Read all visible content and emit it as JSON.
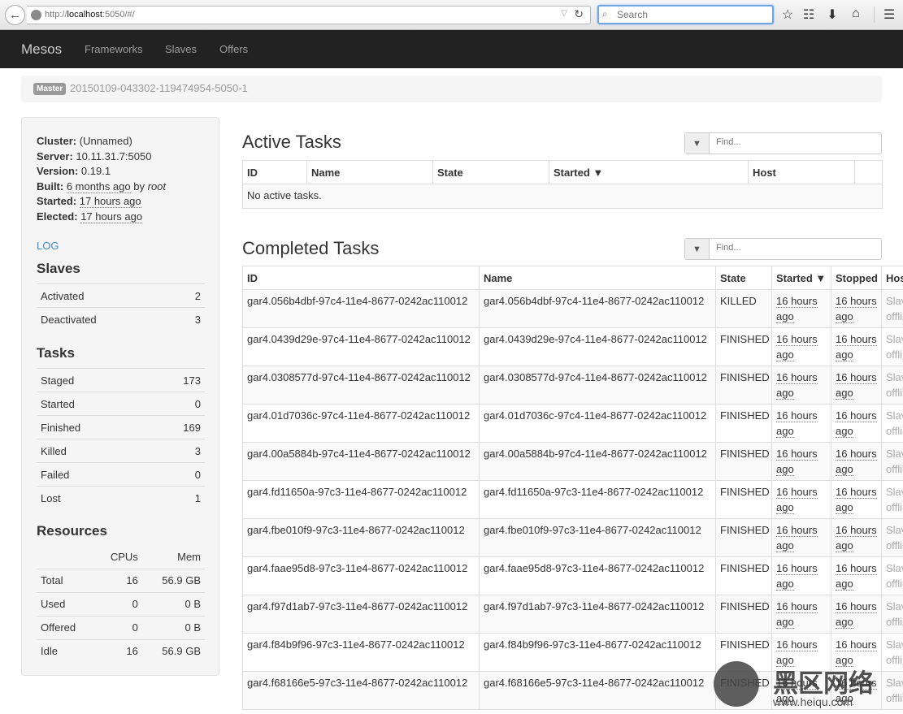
{
  "browser": {
    "url_prefix": "http://",
    "url_host": "localhost",
    "url_suffix": ":5050/#/",
    "search_placeholder": "Search"
  },
  "nav": {
    "brand": "Mesos",
    "links": [
      "Frameworks",
      "Slaves",
      "Offers"
    ]
  },
  "breadcrumb": {
    "label": "Master",
    "id": "20150109-043302-119474954-5050-1"
  },
  "cluster": {
    "cluster_label": "Cluster:",
    "cluster": "(Unnamed)",
    "server_label": "Server:",
    "server": "10.11.31.7:5050",
    "version_label": "Version:",
    "version": "0.19.1",
    "built_label": "Built:",
    "built": "6 months ago",
    "built_by": "by",
    "built_user": "root",
    "started_label": "Started:",
    "started": "17 hours ago",
    "elected_label": "Elected:",
    "elected": "17 hours ago",
    "log": "LOG"
  },
  "slaves": {
    "title": "Slaves",
    "rows": [
      {
        "label": "Activated",
        "value": "2"
      },
      {
        "label": "Deactivated",
        "value": "3"
      }
    ]
  },
  "tasks": {
    "title": "Tasks",
    "rows": [
      {
        "label": "Staged",
        "value": "173"
      },
      {
        "label": "Started",
        "value": "0"
      },
      {
        "label": "Finished",
        "value": "169"
      },
      {
        "label": "Killed",
        "value": "3"
      },
      {
        "label": "Failed",
        "value": "0"
      },
      {
        "label": "Lost",
        "value": "1"
      }
    ]
  },
  "resources": {
    "title": "Resources",
    "cols": [
      "CPUs",
      "Mem"
    ],
    "rows": [
      {
        "label": "Total",
        "cpus": "16",
        "mem": "56.9 GB"
      },
      {
        "label": "Used",
        "cpus": "0",
        "mem": "0 B"
      },
      {
        "label": "Offered",
        "cpus": "0",
        "mem": "0 B"
      },
      {
        "label": "Idle",
        "cpus": "16",
        "mem": "56.9 GB"
      }
    ]
  },
  "active": {
    "title": "Active Tasks",
    "filter_placeholder": "Find...",
    "headers": [
      "ID",
      "Name",
      "State",
      "Started ▼",
      "Host",
      ""
    ],
    "empty": "No active tasks."
  },
  "completed": {
    "title": "Completed Tasks",
    "filter_placeholder": "Find...",
    "headers": [
      "ID",
      "Name",
      "State",
      "Started ▼",
      "Stopped",
      "Host"
    ],
    "rows": [
      {
        "id": "gar4.056b4dbf-97c4-11e4-8677-0242ac110012",
        "name": "gar4.056b4dbf-97c4-11e4-8677-0242ac110012",
        "state": "KILLED",
        "started": "16 hours ago",
        "stopped": "16 hours ago",
        "host": "Slave offline"
      },
      {
        "id": "gar4.0439d29e-97c4-11e4-8677-0242ac110012",
        "name": "gar4.0439d29e-97c4-11e4-8677-0242ac110012",
        "state": "FINISHED",
        "started": "16 hours ago",
        "stopped": "16 hours ago",
        "host": "Slave offline"
      },
      {
        "id": "gar4.0308577d-97c4-11e4-8677-0242ac110012",
        "name": "gar4.0308577d-97c4-11e4-8677-0242ac110012",
        "state": "FINISHED",
        "started": "16 hours ago",
        "stopped": "16 hours ago",
        "host": "Slave offline"
      },
      {
        "id": "gar4.01d7036c-97c4-11e4-8677-0242ac110012",
        "name": "gar4.01d7036c-97c4-11e4-8677-0242ac110012",
        "state": "FINISHED",
        "started": "16 hours ago",
        "stopped": "16 hours ago",
        "host": "Slave offline"
      },
      {
        "id": "gar4.00a5884b-97c4-11e4-8677-0242ac110012",
        "name": "gar4.00a5884b-97c4-11e4-8677-0242ac110012",
        "state": "FINISHED",
        "started": "16 hours ago",
        "stopped": "16 hours ago",
        "host": "Slave offline"
      },
      {
        "id": "gar4.fd11650a-97c3-11e4-8677-0242ac110012",
        "name": "gar4.fd11650a-97c3-11e4-8677-0242ac110012",
        "state": "FINISHED",
        "started": "16 hours ago",
        "stopped": "16 hours ago",
        "host": "Slave offline"
      },
      {
        "id": "gar4.fbe010f9-97c3-11e4-8677-0242ac110012",
        "name": "gar4.fbe010f9-97c3-11e4-8677-0242ac110012",
        "state": "FINISHED",
        "started": "16 hours ago",
        "stopped": "16 hours ago",
        "host": "Slave offline"
      },
      {
        "id": "gar4.faae95d8-97c3-11e4-8677-0242ac110012",
        "name": "gar4.faae95d8-97c3-11e4-8677-0242ac110012",
        "state": "FINISHED",
        "started": "16 hours ago",
        "stopped": "16 hours ago",
        "host": "Slave offline"
      },
      {
        "id": "gar4.f97d1ab7-97c3-11e4-8677-0242ac110012",
        "name": "gar4.f97d1ab7-97c3-11e4-8677-0242ac110012",
        "state": "FINISHED",
        "started": "16 hours ago",
        "stopped": "16 hours ago",
        "host": "Slave offline"
      },
      {
        "id": "gar4.f84b9f96-97c3-11e4-8677-0242ac110012",
        "name": "gar4.f84b9f96-97c3-11e4-8677-0242ac110012",
        "state": "FINISHED",
        "started": "16 hours ago",
        "stopped": "16 hours ago",
        "host": "Slave offline"
      },
      {
        "id": "gar4.f68166e5-97c3-11e4-8677-0242ac110012",
        "name": "gar4.f68166e5-97c3-11e4-8677-0242ac110012",
        "state": "FINISHED",
        "started": "16 hours ago",
        "stopped": "16 hours ago",
        "host": "Slave offline"
      }
    ]
  },
  "watermark": {
    "title": "黑区网络",
    "url": "www.heiqu.com"
  }
}
